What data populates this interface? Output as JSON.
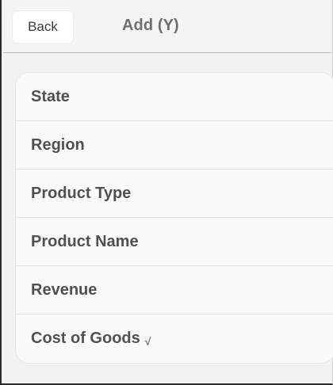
{
  "header": {
    "back_label": "Back",
    "title": "Add (Y)"
  },
  "list": {
    "items": [
      {
        "label": "State",
        "checked": false
      },
      {
        "label": "Region",
        "checked": false
      },
      {
        "label": "Product Type",
        "checked": false
      },
      {
        "label": "Product Name",
        "checked": false
      },
      {
        "label": "Revenue",
        "checked": false
      },
      {
        "label": "Cost of Goods",
        "checked": true,
        "check_mark": "√"
      }
    ]
  }
}
